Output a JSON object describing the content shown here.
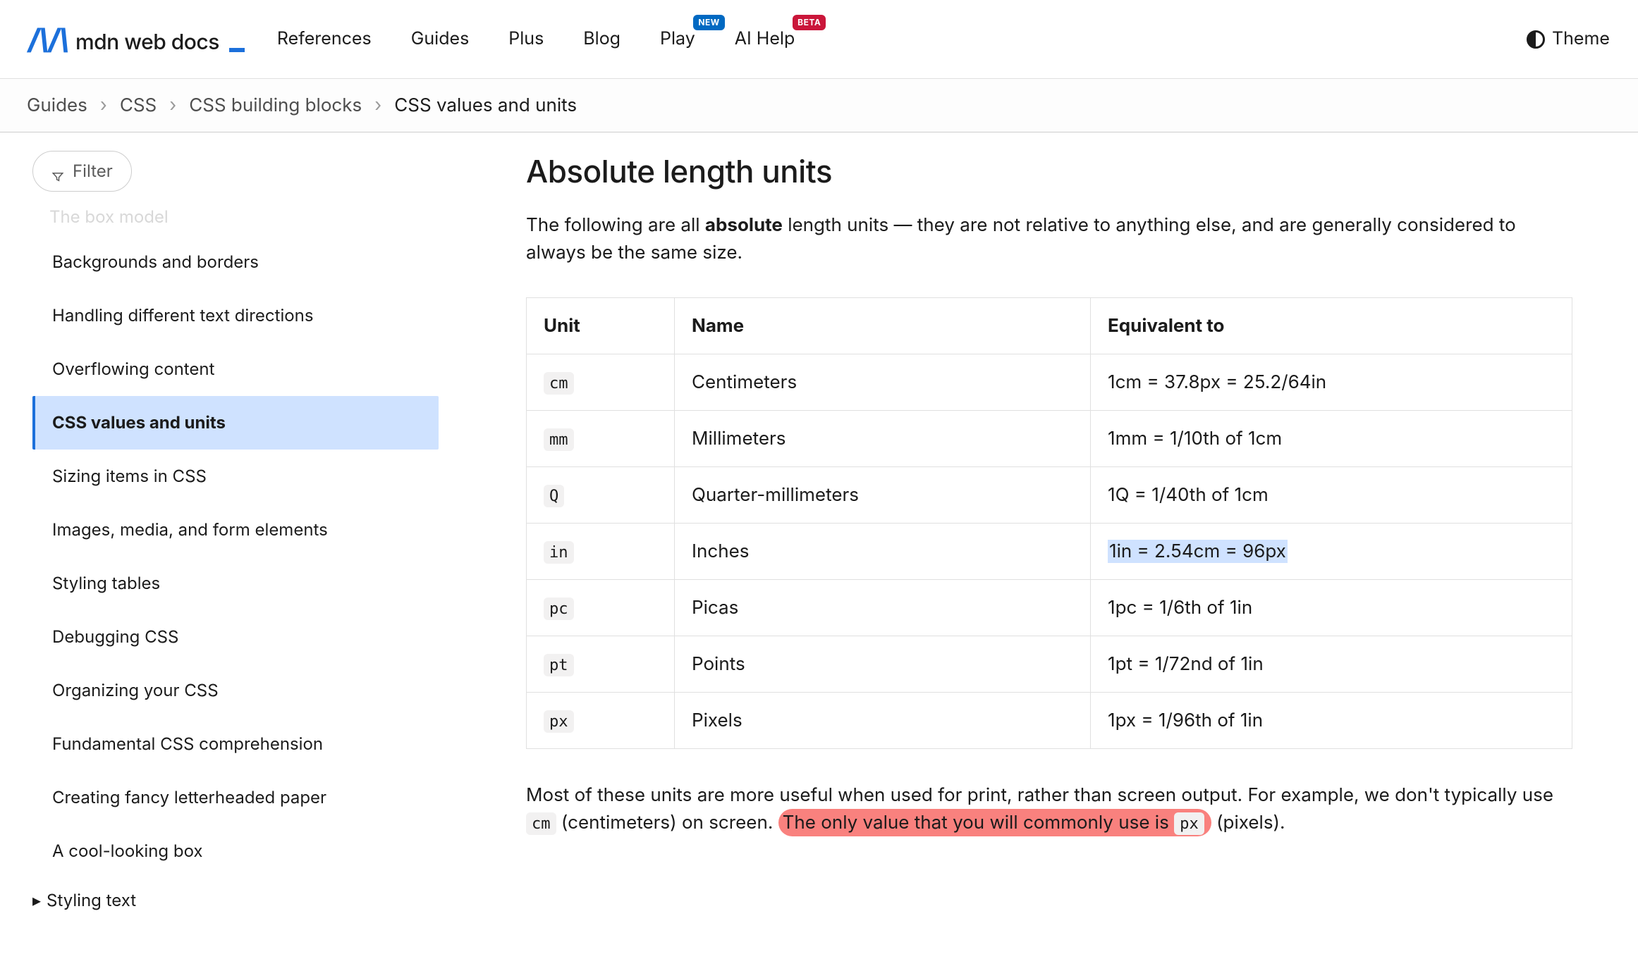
{
  "brand": {
    "name": "mdn web docs"
  },
  "topnav": {
    "items": [
      {
        "label": "References"
      },
      {
        "label": "Guides"
      },
      {
        "label": "Plus"
      },
      {
        "label": "Blog"
      },
      {
        "label": "Play",
        "badge": "NEW"
      },
      {
        "label": "AI Help",
        "badge": "BETA"
      }
    ],
    "theme_label": "Theme"
  },
  "breadcrumb": {
    "items": [
      "Guides",
      "CSS",
      "CSS building blocks",
      "CSS values and units"
    ]
  },
  "sidebar": {
    "filter_label": "Filter",
    "truncated_above": "The box model",
    "items": [
      {
        "label": "Backgrounds and borders",
        "active": false
      },
      {
        "label": "Handling different text directions",
        "active": false
      },
      {
        "label": "Overflowing content",
        "active": false
      },
      {
        "label": "CSS values and units",
        "active": true
      },
      {
        "label": "Sizing items in CSS",
        "active": false
      },
      {
        "label": "Images, media, and form elements",
        "active": false
      },
      {
        "label": "Styling tables",
        "active": false
      },
      {
        "label": "Debugging CSS",
        "active": false
      },
      {
        "label": "Organizing your CSS",
        "active": false
      },
      {
        "label": "Fundamental CSS comprehension",
        "active": false
      },
      {
        "label": "Creating fancy letterheaded paper",
        "active": false
      },
      {
        "label": "A cool-looking box",
        "active": false
      }
    ],
    "next_section": "Styling text"
  },
  "article": {
    "heading": "Absolute length units",
    "lead_pre": "The following are all ",
    "lead_strong": "absolute",
    "lead_post": " length units — they are not relative to anything else, and are generally considered to always be the same size.",
    "table": {
      "headers": [
        "Unit",
        "Name",
        "Equivalent to"
      ],
      "rows": [
        {
          "unit": "cm",
          "name": "Centimeters",
          "equiv": "1cm = 37.8px = 25.2/64in",
          "highlight": false
        },
        {
          "unit": "mm",
          "name": "Millimeters",
          "equiv": "1mm = 1/10th of 1cm",
          "highlight": false
        },
        {
          "unit": "Q",
          "name": "Quarter-millimeters",
          "equiv": "1Q = 1/40th of 1cm",
          "highlight": false
        },
        {
          "unit": "in",
          "name": "Inches",
          "equiv": "1in = 2.54cm = 96px",
          "highlight": true
        },
        {
          "unit": "pc",
          "name": "Picas",
          "equiv": "1pc = 1/6th of 1in",
          "highlight": false
        },
        {
          "unit": "pt",
          "name": "Points",
          "equiv": "1pt = 1/72nd of 1in",
          "highlight": false
        },
        {
          "unit": "px",
          "name": "Pixels",
          "equiv": "1px = 1/96th of 1in",
          "highlight": false
        }
      ]
    },
    "follow": {
      "p1": "Most of these units are more useful when used for print, rather than screen output. For example, we don't typically use ",
      "code1": "cm",
      "p2": " (centimeters) on screen. ",
      "red": "The only value that you will commonly use is ",
      "code2": "px",
      "p3": " (pixels)."
    }
  }
}
